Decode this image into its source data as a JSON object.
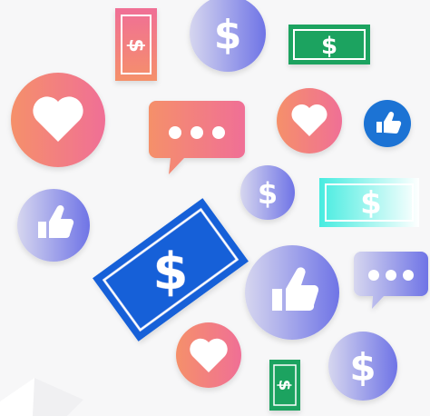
{
  "icons": [
    {
      "name": "dollar-bill-icon",
      "kind": "bill",
      "style": "coral-pink"
    },
    {
      "name": "dollar-coin-icon",
      "kind": "coin",
      "style": "violet-gradient"
    },
    {
      "name": "dollar-bill-icon",
      "kind": "bill",
      "style": "green"
    },
    {
      "name": "heart-icon",
      "kind": "heart-bubble",
      "style": "coral-pink"
    },
    {
      "name": "chat-bubble-icon",
      "kind": "chat",
      "style": "coral-pink"
    },
    {
      "name": "heart-icon",
      "kind": "heart-bubble",
      "style": "coral-pink"
    },
    {
      "name": "thumbs-up-icon",
      "kind": "like",
      "style": "blue"
    },
    {
      "name": "dollar-coin-icon",
      "kind": "coin",
      "style": "violet-gradient"
    },
    {
      "name": "dollar-bill-icon",
      "kind": "bill",
      "style": "cyan-fade"
    },
    {
      "name": "thumbs-up-icon",
      "kind": "like",
      "style": "violet-gradient"
    },
    {
      "name": "dollar-bill-icon",
      "kind": "bill",
      "style": "royal-blue"
    },
    {
      "name": "thumbs-up-icon",
      "kind": "like",
      "style": "violet-gradient"
    },
    {
      "name": "chat-bubble-icon",
      "kind": "chat",
      "style": "violet-gradient"
    },
    {
      "name": "heart-icon",
      "kind": "heart-bubble",
      "style": "coral-pink"
    },
    {
      "name": "dollar-bill-icon",
      "kind": "bill",
      "style": "green"
    },
    {
      "name": "dollar-coin-icon",
      "kind": "coin",
      "style": "violet-gradient"
    }
  ],
  "colors": {
    "background": "#f7f7f8",
    "coral": "#f5906a",
    "pink": "#f06f96",
    "violet": "#7d7fe8",
    "lavender": "#c9c9ee",
    "green": "#1fa360",
    "blue": "#1760d8",
    "cyan": "#57eee0"
  }
}
